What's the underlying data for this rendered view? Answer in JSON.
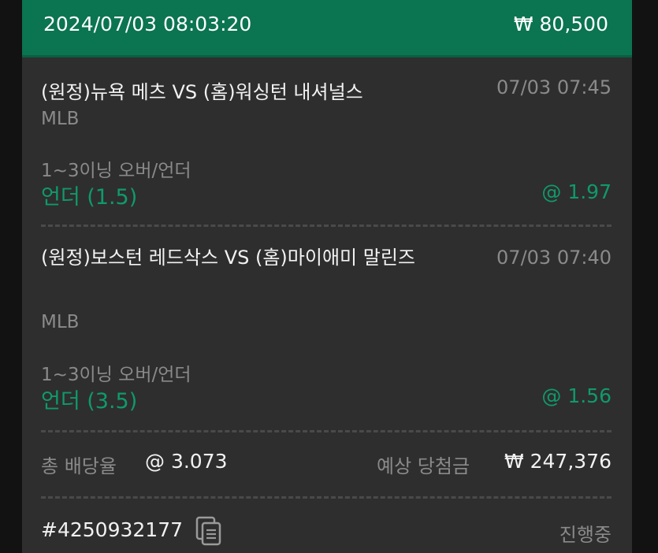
{
  "header": {
    "datetime": "2024/07/03 08:03:20",
    "stake": "₩ 80,500"
  },
  "bets": [
    {
      "match": "(원정)뉴욕 메츠 VS (홈)워싱턴 내셔널스",
      "time": "07/03 07:45",
      "league": "MLB",
      "market": "1~3이닝 오버/언더",
      "pick": "언더 (1.5)",
      "odds": "@ 1.97"
    },
    {
      "match": "(원정)보스턴 레드삭스 VS (홈)마이애미 말린즈",
      "time": "07/03 07:40",
      "league": "MLB",
      "market": "1~3이닝 오버/언더",
      "pick": "언더 (3.5)",
      "odds": "@ 1.56"
    }
  ],
  "summary": {
    "total_odds_label": "총 배당율",
    "total_odds": "@ 3.073",
    "expected_label": "예상 당첨금",
    "expected_amount": "₩ 247,376"
  },
  "footer": {
    "ticket_id": "#4250932177",
    "copy_icon": "copy-document-icon",
    "status": "진행중"
  },
  "colors": {
    "header_bg": "#0b7450",
    "card_bg": "#2e2e2e",
    "accent_green": "#0f9a6a"
  }
}
